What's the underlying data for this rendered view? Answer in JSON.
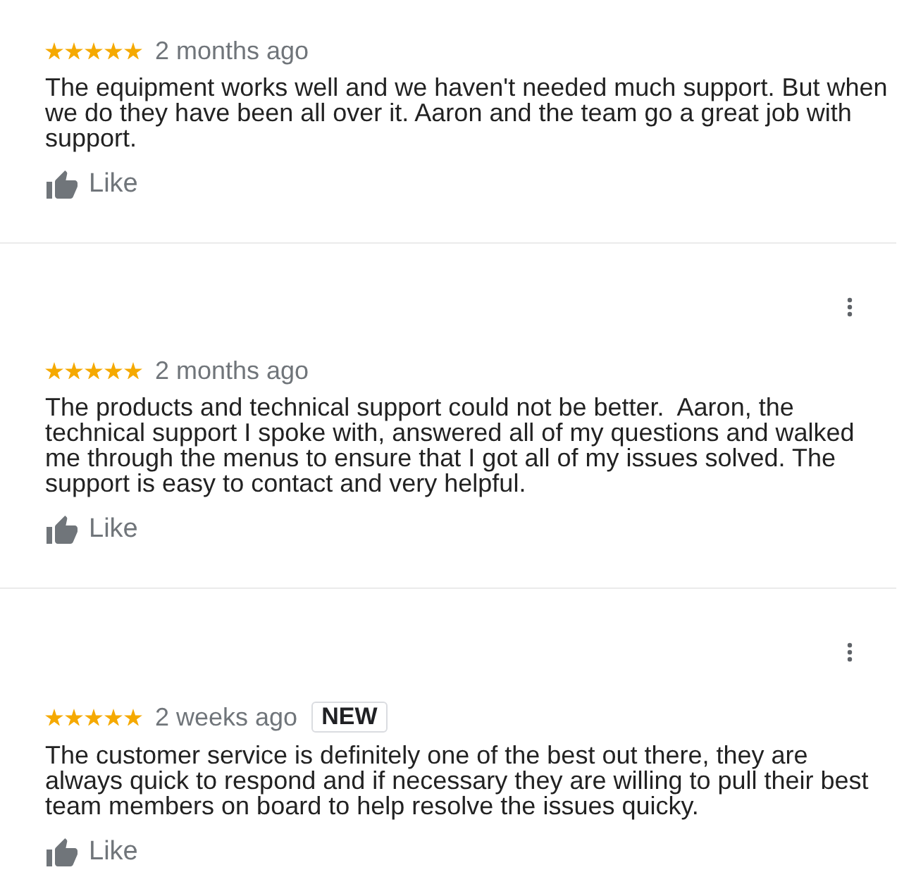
{
  "reviews": [
    {
      "more_menu": false,
      "stars": 5,
      "time": "2 months ago",
      "text": "The equipment works well and we haven't needed much support. But when we do they have been all over it. Aaron and the team go a great job with support.",
      "like": "Like"
    },
    {
      "more_menu": true,
      "stars": 5,
      "time": "2 months ago",
      "text": "The products and technical support could not be better.  Aaron, the technical support I spoke with, answered all of my questions and walked me through the menus to ensure that I got all of my issues solved. The support is easy to contact and very helpful.",
      "like": "Like"
    },
    {
      "more_menu": true,
      "stars": 5,
      "time": "2 weeks ago",
      "badge": "NEW",
      "text": "The customer service is definitely one of the best out there, they are always quick to respond and if necessary they are willing to pull their best team members on board to help resolve the issues quicky.",
      "like": "Like"
    }
  ]
}
